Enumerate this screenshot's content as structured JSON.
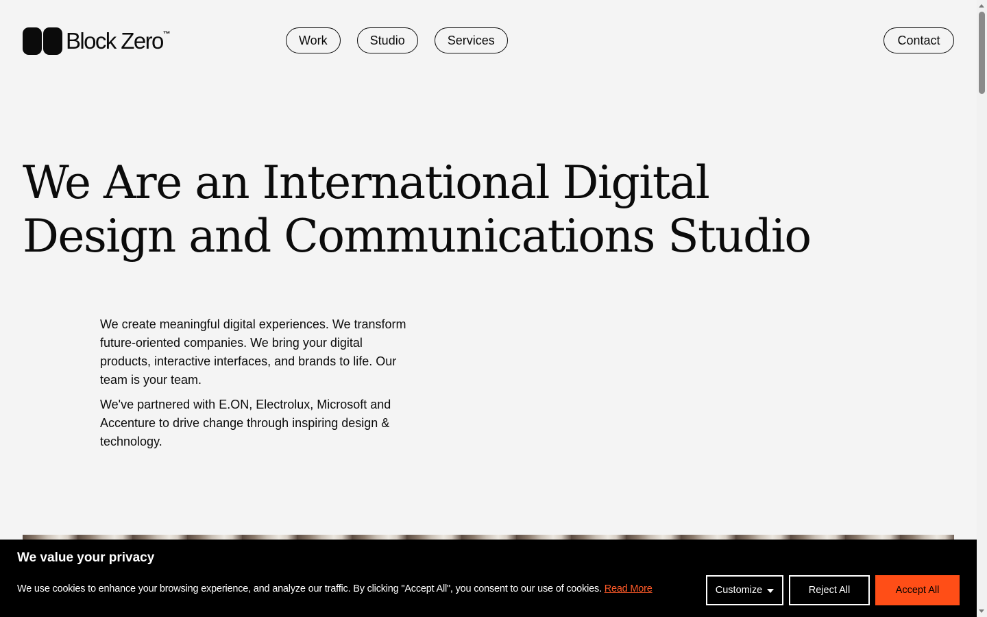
{
  "brand": {
    "name": "Block Zero",
    "trademark": "™"
  },
  "nav": {
    "items": [
      "Work",
      "Studio",
      "Services"
    ],
    "contact": "Contact"
  },
  "hero": {
    "title_line1": "We Are an International Digital",
    "title_line2": "Design and Communications Studio",
    "paragraph1": "We create meaningful digital experiences. We transform future-oriented companies. We bring your digital products, interactive interfaces, and brands to life. Our team is your team.",
    "paragraph2": "We've partnered with E.ON, Electrolux, Microsoft and Accenture to drive change through inspiring design & technology."
  },
  "cookie_banner": {
    "title": "We value your privacy",
    "text": "We use cookies to enhance your browsing experience, and analyze our traffic. By clicking \"Accept All\", you consent to our use of cookies.",
    "read_more": "Read More",
    "customize": "Customize",
    "reject": "Reject All",
    "accept": "Accept All"
  },
  "colors": {
    "background": "#f4f4f4",
    "text": "#0b0b0b",
    "accent": "#ff4e17",
    "banner": "#000000"
  }
}
